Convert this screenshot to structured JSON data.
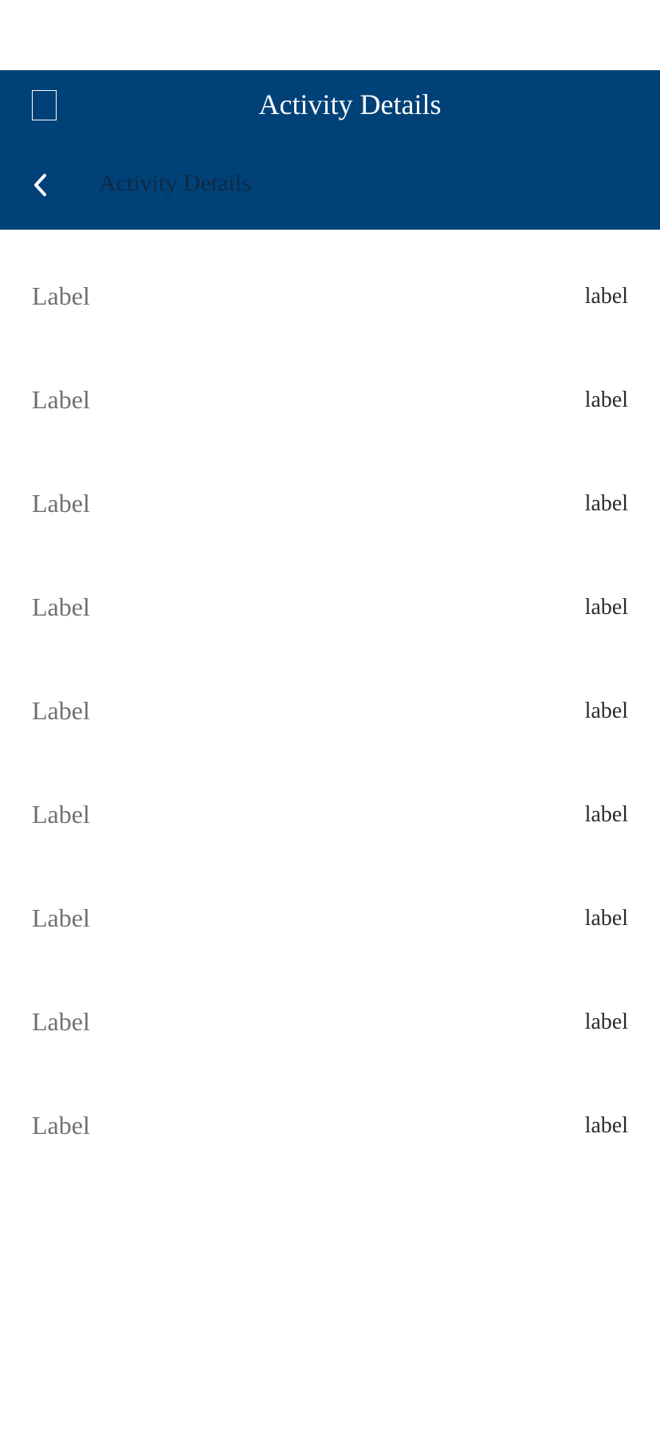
{
  "header": {
    "title": "Activity Details",
    "subtitle": "Activity Details",
    "background_color": "#004278",
    "menu_icon": "menu-icon",
    "back_icon": "chevron-left-icon"
  },
  "rows": [
    {
      "label": "Label",
      "value": "label"
    },
    {
      "label": "Label",
      "value": "label"
    },
    {
      "label": "Label",
      "value": "label"
    },
    {
      "label": "Label",
      "value": "label"
    },
    {
      "label": "Label",
      "value": "label"
    },
    {
      "label": "Label",
      "value": "label"
    },
    {
      "label": "Label",
      "value": "label"
    },
    {
      "label": "Label",
      "value": "label"
    },
    {
      "label": "Label",
      "value": "label"
    }
  ]
}
